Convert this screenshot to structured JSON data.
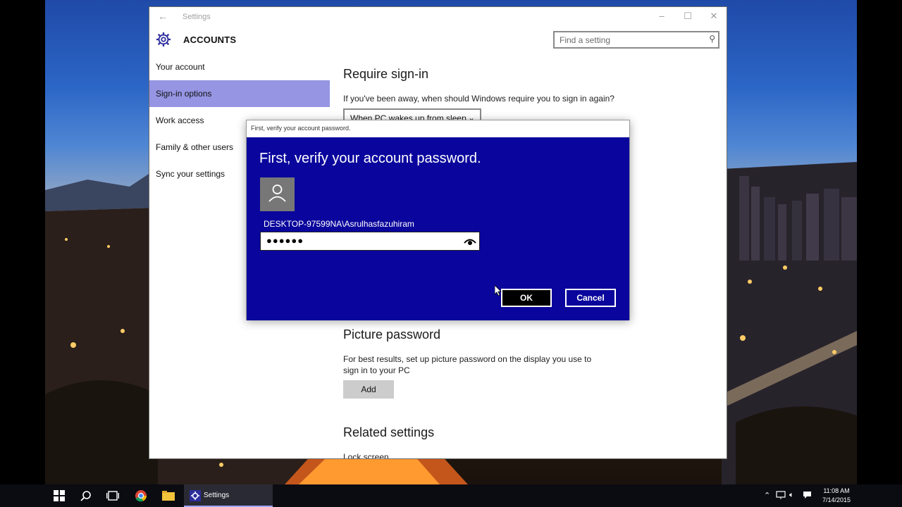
{
  "window": {
    "title": "Settings",
    "section": "ACCOUNTS",
    "search_placeholder": "Find a setting"
  },
  "sidebar": {
    "items": [
      {
        "label": "Your account"
      },
      {
        "label": "Sign-in options",
        "selected": true
      },
      {
        "label": "Work access"
      },
      {
        "label": "Family & other users"
      },
      {
        "label": "Sync your settings"
      }
    ]
  },
  "content": {
    "require_signin": {
      "heading": "Require sign-in",
      "question": "If you've been away, when should Windows require you to sign in again?",
      "dropdown_value": "When PC wakes up from sleep"
    },
    "picture_password": {
      "heading": "Picture password",
      "description": "For best results, set up picture password on the display you use to sign in to your PC",
      "add_label": "Add"
    },
    "related": {
      "heading": "Related settings",
      "link": "Lock screen"
    }
  },
  "dialog": {
    "titlebar": "First, verify your account password.",
    "heading": "First, verify your account password.",
    "account": "DESKTOP-97599NA\\Asrulhasfazuhiram",
    "password_masked": "●●●●●●",
    "ok_label": "OK",
    "cancel_label": "Cancel"
  },
  "taskbar": {
    "active_app": "Settings",
    "time": "11:08 AM",
    "date": "7/14/2015"
  },
  "colors": {
    "accent": "#9595e3",
    "dialog_bg": "#0a059c",
    "taskbar_bg": "#0b0b12"
  },
  "icons": [
    "back-arrow-icon",
    "gear-icon",
    "search-icon",
    "user-avatar-icon",
    "reveal-password-eye-icon",
    "windows-start-icon",
    "cortana-search-icon",
    "task-view-icon",
    "chrome-icon",
    "file-explorer-icon",
    "network-icon",
    "volume-icon",
    "action-center-icon"
  ]
}
